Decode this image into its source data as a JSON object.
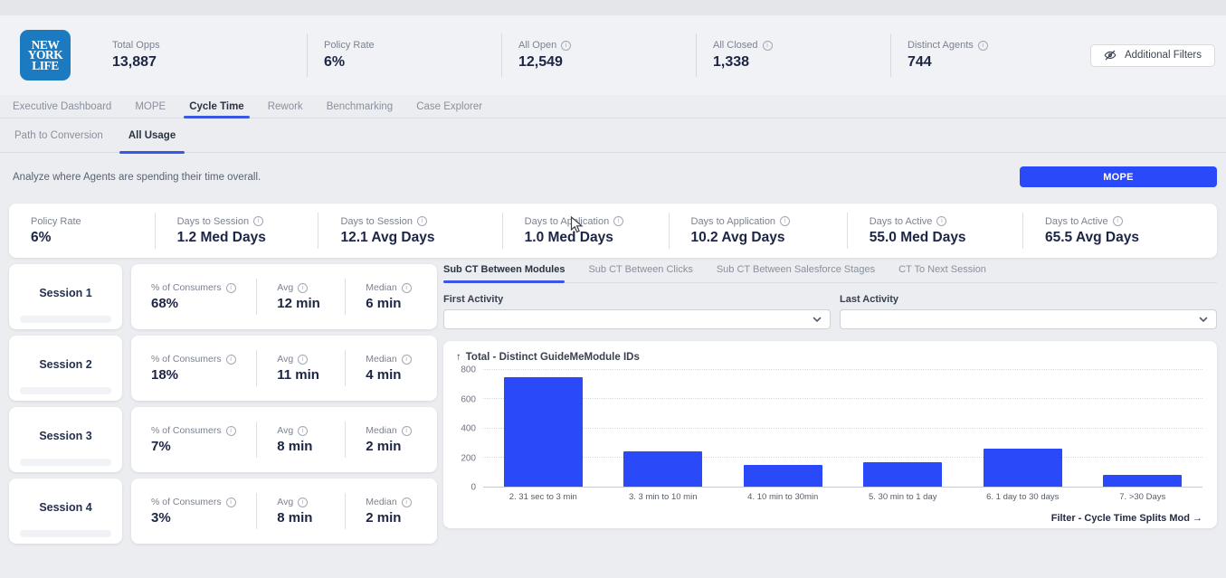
{
  "colors": {
    "accent": "#2a49f8",
    "logo_blue": "#1b7ac0",
    "value_navy": "#1c2544",
    "bar_blue": "#2a49f9"
  },
  "header": {
    "logo_lines": [
      "NEW",
      "YORK",
      "LIFE"
    ],
    "stats": [
      {
        "label": "Total Opps",
        "value": "13,887",
        "info": false
      },
      {
        "label": "Policy Rate",
        "value": "6%",
        "info": false
      },
      {
        "label": "All Open",
        "value": "12,549",
        "info": true
      },
      {
        "label": "All Closed",
        "value": "1,338",
        "info": true
      },
      {
        "label": "Distinct Agents",
        "value": "744",
        "info": true
      }
    ],
    "additional_filters_label": "Additional Filters"
  },
  "nav": {
    "tabs": [
      {
        "label": "Executive Dashboard",
        "active": false
      },
      {
        "label": "MOPE",
        "active": false
      },
      {
        "label": "Cycle Time",
        "active": true
      },
      {
        "label": "Rework",
        "active": false
      },
      {
        "label": "Benchmarking",
        "active": false
      },
      {
        "label": "Case Explorer",
        "active": false
      }
    ]
  },
  "subnav": {
    "tabs": [
      {
        "label": "Path to Conversion",
        "active": false
      },
      {
        "label": "All Usage",
        "active": true
      }
    ]
  },
  "toolbar": {
    "description": "Analyze where Agents are spending their time overall.",
    "mope_label": "MOPE"
  },
  "kpis": [
    {
      "label": "Policy Rate",
      "value": "6%",
      "info": false
    },
    {
      "label": "Days to Session",
      "value": "1.2 Med Days",
      "info": true
    },
    {
      "label": "Days to Session",
      "value": "12.1 Avg Days",
      "info": true
    },
    {
      "label": "Days to Application",
      "value": "1.0 Med Days",
      "info": true
    },
    {
      "label": "Days to Application",
      "value": "10.2 Avg Days",
      "info": true
    },
    {
      "label": "Days to Active",
      "value": "55.0 Med Days",
      "info": true
    },
    {
      "label": "Days to Active",
      "value": "65.5 Avg Days",
      "info": true
    }
  ],
  "sessions": [
    {
      "label": "Session 1",
      "stats": [
        {
          "label": "% of Consumers",
          "value": "68%"
        },
        {
          "label": "Avg",
          "value": "12 min"
        },
        {
          "label": "Median",
          "value": "6 min"
        }
      ]
    },
    {
      "label": "Session 2",
      "stats": [
        {
          "label": "% of Consumers",
          "value": "18%"
        },
        {
          "label": "Avg",
          "value": "11 min"
        },
        {
          "label": "Median",
          "value": "4 min"
        }
      ]
    },
    {
      "label": "Session 3",
      "stats": [
        {
          "label": "% of Consumers",
          "value": "7%"
        },
        {
          "label": "Avg",
          "value": "8 min"
        },
        {
          "label": "Median",
          "value": "2 min"
        }
      ]
    },
    {
      "label": "Session 4",
      "stats": [
        {
          "label": "% of Consumers",
          "value": "3%"
        },
        {
          "label": "Avg",
          "value": "8 min"
        },
        {
          "label": "Median",
          "value": "2 min"
        }
      ]
    }
  ],
  "panel": {
    "tabs": [
      {
        "label": "Sub CT Between Modules",
        "active": true
      },
      {
        "label": "Sub CT Between Clicks",
        "active": false
      },
      {
        "label": "Sub CT Between Salesforce Stages",
        "active": false
      },
      {
        "label": "CT To Next Session",
        "active": false
      }
    ],
    "first_activity_label": "First Activity",
    "last_activity_label": "Last Activity",
    "first_activity_value": "",
    "last_activity_value": "",
    "filter_link": "Filter - Cycle Time Splits Mod →"
  },
  "chart_data": {
    "type": "bar",
    "sort_arrow": "↑",
    "title": "Total - Distinct GuideMeModule IDs",
    "categories": [
      "2. 31 sec to 3 min",
      "3. 3 min to 10 min",
      "4. 10 min to 30min",
      "5. 30 min to 1 day",
      "6. 1 day to 30 days",
      "7. >30 Days"
    ],
    "values": [
      750,
      245,
      150,
      165,
      260,
      80
    ],
    "ylim": [
      0,
      800
    ],
    "yticks": [
      0,
      200,
      400,
      600,
      800
    ],
    "grid": "dotted-horizontal",
    "legend": "none",
    "bar_color": "#2a49f9"
  }
}
